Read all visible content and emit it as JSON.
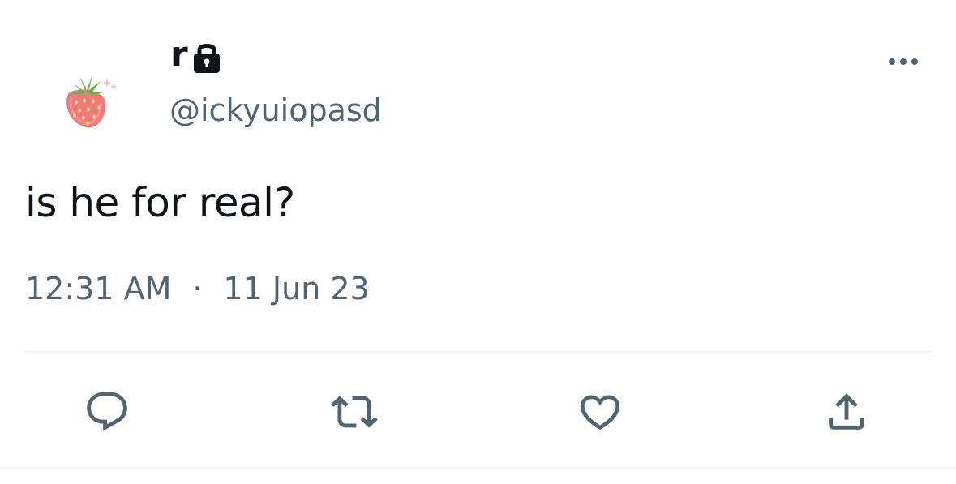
{
  "author": {
    "display_name": "r",
    "handle": "@ickyuiopasd",
    "avatar": "strawberry-avatar",
    "protected_icon": "lock-icon"
  },
  "tweet": {
    "text": "is he for real?",
    "time": "12:31 AM",
    "separator": "·",
    "date": "11 Jun 23"
  },
  "actions": {
    "reply_icon": "reply-icon",
    "retweet_icon": "retweet-icon",
    "like_icon": "heart-icon",
    "share_icon": "share-icon"
  },
  "more_icon": "more-horizontal-icon",
  "colors": {
    "primary_text": "#0f1419",
    "secondary_text": "#536471",
    "divider": "#eff3f4",
    "strawberry_red": "#ef6f74",
    "strawberry_leaf": "#6fae4a"
  }
}
